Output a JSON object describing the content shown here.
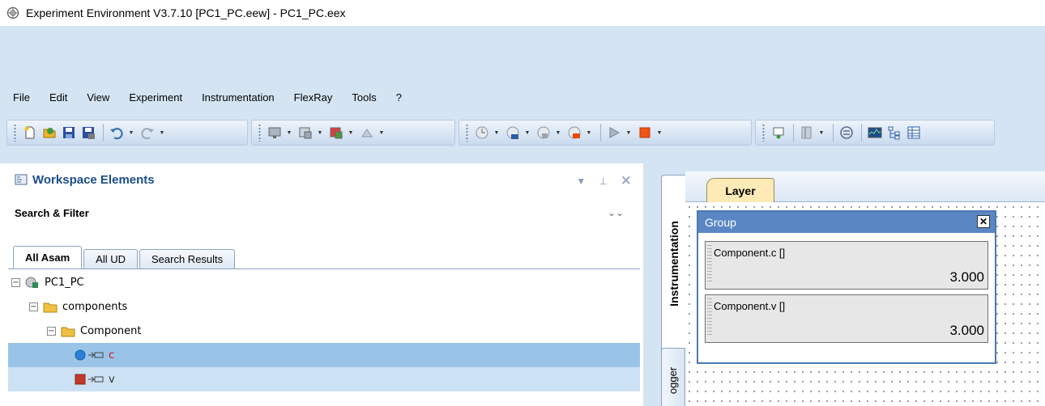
{
  "window": {
    "title": "Experiment Environment V3.7.10  [PC1_PC.eew] - PC1_PC.eex"
  },
  "menubar": {
    "items": [
      "File",
      "Edit",
      "View",
      "Experiment",
      "Instrumentation",
      "FlexRay",
      "Tools",
      "?"
    ]
  },
  "toolbar": {
    "icons": [
      "new-icon",
      "open-icon",
      "save-icon",
      "save-as-icon",
      "undo-icon",
      "redo-icon",
      "monitor-icon",
      "window-icon",
      "window-color-icon",
      "import-icon",
      "clock-icon",
      "clock-start-icon",
      "clock-stop-icon",
      "clock-set-icon",
      "play-icon",
      "stop-icon",
      "dataset-icon",
      "book-icon",
      "link-icon",
      "oscilloscope-icon",
      "tree-icon",
      "table-icon"
    ]
  },
  "workspace": {
    "title": "Workspace Elements",
    "search_filter": "Search & Filter",
    "tabs": [
      "All Asam",
      "All UD",
      "Search Results"
    ],
    "active_tab": "All Asam",
    "tree": [
      {
        "label": "PC1_PC",
        "expanded": true
      },
      {
        "label": "components",
        "expanded": true
      },
      {
        "label": "Component",
        "expanded": true
      },
      {
        "label": "c"
      },
      {
        "label": "v"
      }
    ]
  },
  "right": {
    "vertical_tabs": [
      "Instrumentation",
      "ogger"
    ],
    "layer_tab": "Layer",
    "group": {
      "title": "Group",
      "components": [
        {
          "name": "Component.c []",
          "value": "3.000"
        },
        {
          "name": "Component.v []",
          "value": "3.000"
        }
      ]
    }
  }
}
